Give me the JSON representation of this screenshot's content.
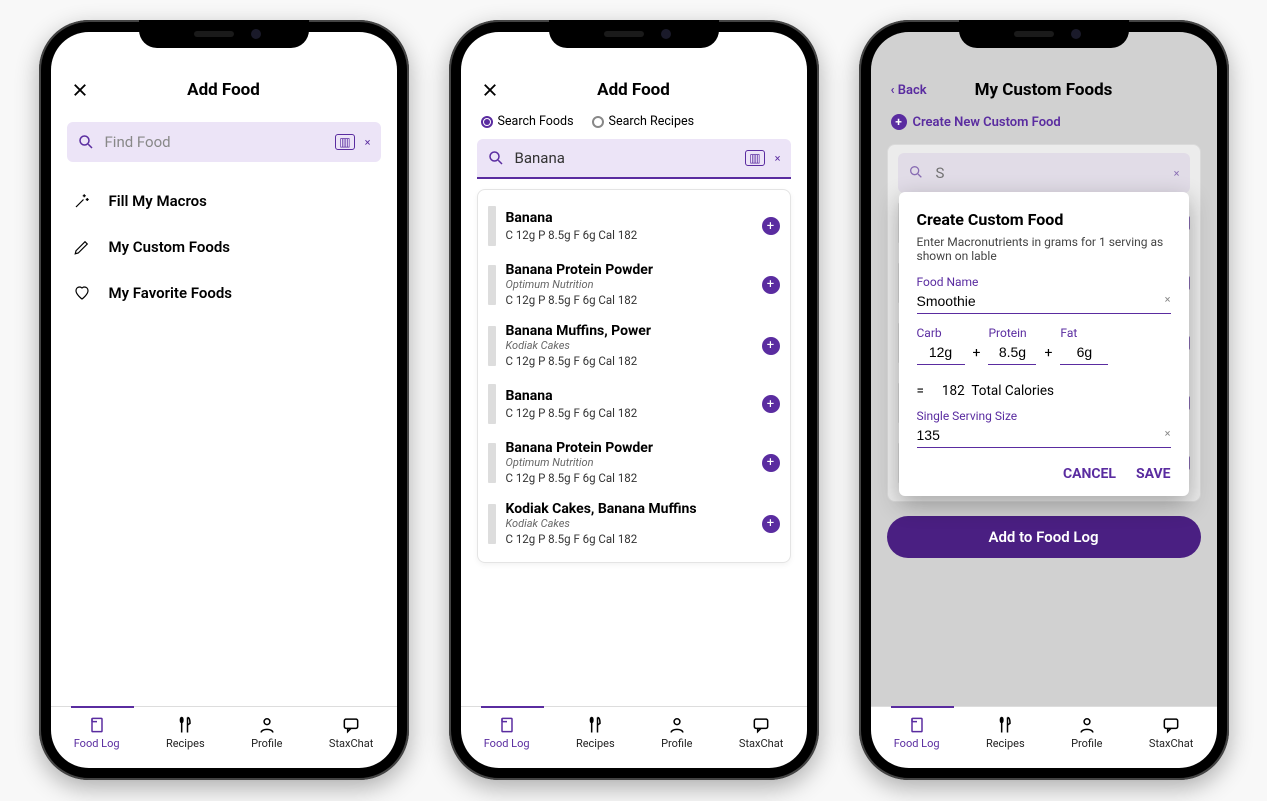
{
  "nav": {
    "items": [
      "Food Log",
      "Recipes",
      "Profile",
      "StaxChat"
    ],
    "active": 0
  },
  "screen1": {
    "title": "Add Food",
    "search_placeholder": "Find Food",
    "menu": [
      "Fill My Macros",
      "My Custom Foods",
      "My Favorite Foods"
    ]
  },
  "screen2": {
    "title": "Add Food",
    "radios": {
      "foods": "Search Foods",
      "recipes": "Search Recipes",
      "selected": "foods"
    },
    "search_value": "Banana",
    "macro_template": "C 12g   P 8.5g   F 6g   Cal 182",
    "results": [
      {
        "name": "Banana",
        "brand": "",
        "macros": "C 12g   P 8.5g   F 6g   Cal 182"
      },
      {
        "name": "Banana Protein Powder",
        "brand": "Optimum Nutrition",
        "macros": "C 12g   P 8.5g   F 6g   Cal 182"
      },
      {
        "name": "Banana Muffins, Power",
        "brand": "Kodiak Cakes",
        "macros": "C 12g   P 8.5g   F 6g   Cal 182"
      },
      {
        "name": "Banana",
        "brand": "",
        "macros": "C 12g   P 8.5g   F 6g   Cal 182"
      },
      {
        "name": "Banana Protein Powder",
        "brand": "Optimum Nutrition",
        "macros": "C 12g   P 8.5g   F 6g   Cal 182"
      },
      {
        "name": "Kodiak Cakes, Banana Muffins",
        "brand": "Kodiak Cakes",
        "macros": "C 12g   P 8.5g   F 6g   Cal 182"
      }
    ]
  },
  "screen3": {
    "back_label": "Back",
    "title": "My Custom Foods",
    "create_link": "Create New Custom Food",
    "bg_checks": [
      false,
      true,
      false,
      true,
      false
    ],
    "add_btn": "Add to Food Log",
    "modal": {
      "title": "Create Custom Food",
      "sub": "Enter Macronutrients in grams for 1 serving as shown on lable",
      "name_label": "Food Name",
      "name_value": "Smoothie",
      "carb_label": "Carb",
      "carb_value": "12g",
      "protein_label": "Protein",
      "protein_value": "8.5g",
      "fat_label": "Fat",
      "fat_value": "6g",
      "total_eq": "=",
      "total_value": "182",
      "total_label": "Total Calories",
      "serving_label": "Single Serving Size",
      "serving_value": "135",
      "cancel": "CANCEL",
      "save": "SAVE"
    }
  }
}
